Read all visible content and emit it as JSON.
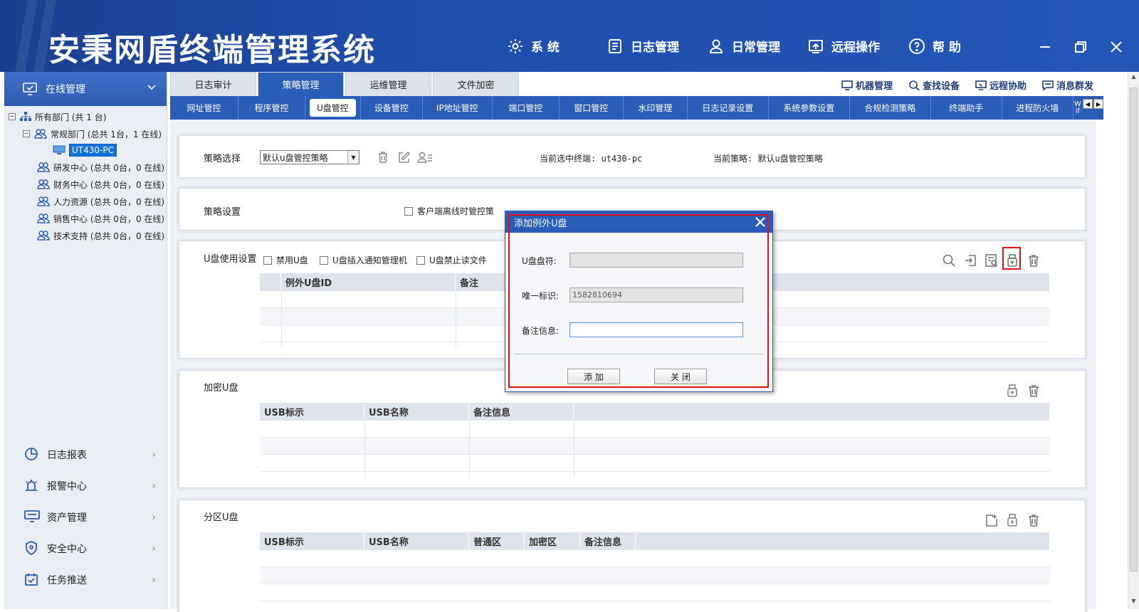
{
  "app": {
    "title": "安秉网盾终端管理系统",
    "topnav": [
      {
        "label": "系 统",
        "icon": "gear-icon"
      },
      {
        "label": "日志管理",
        "icon": "log-icon"
      },
      {
        "label": "日常管理",
        "icon": "user-icon"
      },
      {
        "label": "远程操作",
        "icon": "remote-icon"
      },
      {
        "label": "帮 助",
        "icon": "help-icon"
      }
    ]
  },
  "sidebar": {
    "header": "在线管理",
    "tree": {
      "root": "所有部门 (共 1 台)",
      "groups": [
        {
          "label": "常规部门 (总共 1台，1 在线)"
        },
        {
          "label": "研发中心 (总共 0台，0 在线)"
        },
        {
          "label": "财务中心 (总共 0台，0 在线)"
        },
        {
          "label": "人力资源 (总共 0台，0 在线)"
        },
        {
          "label": "销售中心 (总共 0台，0 在线)"
        },
        {
          "label": "技术支持 (总共 0台，0 在线)"
        }
      ],
      "selected_pc": "UT430-PC"
    },
    "menu": [
      {
        "label": "日志报表",
        "icon": "pie-chart-icon"
      },
      {
        "label": "报警中心",
        "icon": "alarm-icon"
      },
      {
        "label": "资产管理",
        "icon": "monitor-icon"
      },
      {
        "label": "安全中心",
        "icon": "shield-icon"
      },
      {
        "label": "任务推送",
        "icon": "calendar-check-icon"
      }
    ]
  },
  "tabs": [
    "日志审计",
    "策略管理",
    "运维管理",
    "文件加密"
  ],
  "active_tab": "策略管理",
  "tools": [
    "机器管理",
    "查找设备",
    "远程协助",
    "消息群发"
  ],
  "subnav": [
    "网址管控",
    "程序管控",
    "U盘管控",
    "设备管控",
    "IP地址管控",
    "端口管控",
    "窗口管控",
    "水印管理",
    "日志记录设置",
    "系统参数设置",
    "合规检测策略",
    "终端助手",
    "进程防火墙",
    "W",
    "if"
  ],
  "active_subnav": "U盘管控",
  "strategy": {
    "select_label": "策略选择",
    "select_value": "默认u盘管控策略",
    "current_terminal_label": "当前选中终端:",
    "current_terminal_value": "ut430-pc",
    "current_policy_label": "当前策略:",
    "current_policy_value": "默认u盘管控策略"
  },
  "policy_settings": {
    "label": "策略设置",
    "offline_checkbox": "客户端离线时管控策"
  },
  "usb_usage": {
    "label": "U盘使用设置",
    "checkboxes": [
      "禁用U盘",
      "U盘插入通知管理机",
      "U盘禁止读文件"
    ],
    "columns": [
      "例外U盘ID",
      "备注"
    ]
  },
  "encrypted_usb": {
    "label": "加密U盘",
    "columns": [
      "USB标示",
      "USB名称",
      "备注信息"
    ]
  },
  "partition_usb": {
    "label": "分区U盘",
    "columns": [
      "USB标示",
      "USB名称",
      "普通区",
      "加密区",
      "备注信息"
    ]
  },
  "modal": {
    "title": "添加例外U盘",
    "drive_label": "U盘盘符:",
    "drive_value": "",
    "id_label": "唯一标识:",
    "id_value": "1582810694",
    "note_label": "备注信息:",
    "note_value": "",
    "add_button": "添 加",
    "close_button": "关 闭"
  },
  "colors": {
    "brand_blue": "#2a5db8",
    "title_bar": "#1f4fae",
    "highlight_red": "#e0101a"
  }
}
